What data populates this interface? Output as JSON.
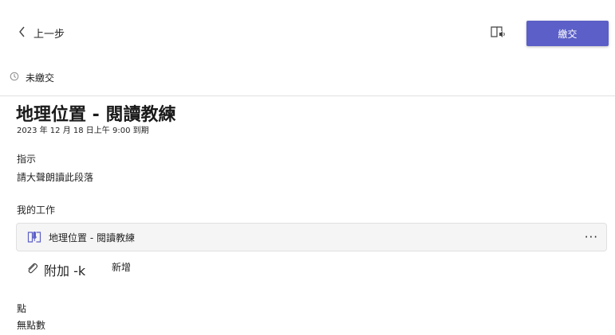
{
  "header": {
    "back_label": "上一步",
    "submit_label": "繳交"
  },
  "status": {
    "text": "未繳交"
  },
  "assignment": {
    "title": "地理位置 - 閱讀教練",
    "due": "2023 年 12 月 18 日上午 9:00 到期"
  },
  "instructions": {
    "label": "指示",
    "text": "請大聲朗讀此段落"
  },
  "my_work": {
    "label": "我的工作",
    "item_title": "地理位置 - 閱讀教練",
    "more_label": "···",
    "attach_label": "附加 -k",
    "new_label": "新增"
  },
  "points": {
    "label": "點",
    "value": "無點數"
  },
  "colors": {
    "accent": "#5b5fc7",
    "card_background": "#f5f5f5"
  },
  "icons": {
    "back": "chevron-left-icon",
    "reader": "immersive-reader-icon",
    "status": "clock-icon",
    "work_item": "reading-coach-icon",
    "attach": "paperclip-icon"
  }
}
